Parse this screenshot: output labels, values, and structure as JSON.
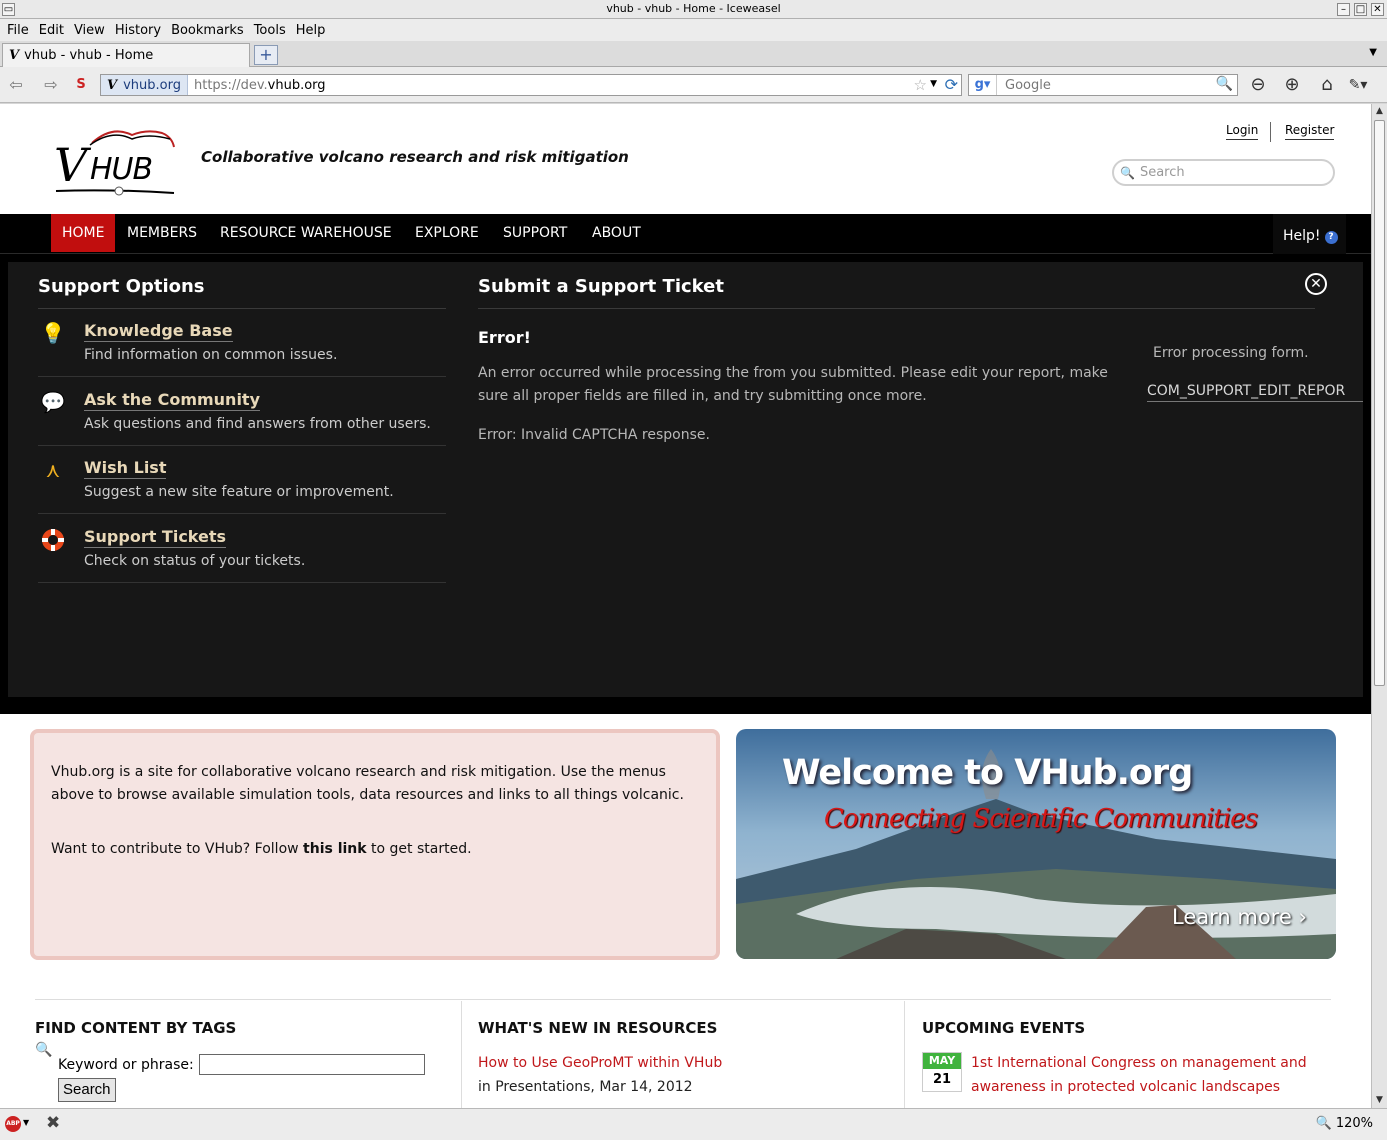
{
  "window": {
    "title": "vhub - vhub - Home - Iceweasel",
    "menu": [
      "File",
      "Edit",
      "View",
      "History",
      "Bookmarks",
      "Tools",
      "Help"
    ],
    "tab_title": "vhub - vhub - Home",
    "identity": "vhub.org",
    "url_prefix": "https://dev.",
    "url_host": "vhub.org",
    "search_engine": "Google",
    "zoom": "120%"
  },
  "header": {
    "logo_text": "VHUB",
    "tagline": "Collaborative volcano research and risk mitigation",
    "login": "Login",
    "register": "Register",
    "search_placeholder": "Search"
  },
  "nav": {
    "items": [
      "HOME",
      "MEMBERS",
      "RESOURCE WAREHOUSE",
      "EXPLORE",
      "SUPPORT",
      "ABOUT"
    ],
    "active": "HOME",
    "help": "Help!",
    "active_color": "#c10e0e"
  },
  "support": {
    "options_title": "Support Options",
    "options": [
      {
        "title": "Knowledge Base",
        "desc": "Find information on common issues.",
        "icon": "lightbulb-icon"
      },
      {
        "title": "Ask the Community",
        "desc": "Ask questions and find answers from other users.",
        "icon": "chat-bubbles-icon"
      },
      {
        "title": "Wish List",
        "desc": "Suggest a new site feature or improvement.",
        "icon": "wishbone-icon"
      },
      {
        "title": "Support Tickets",
        "desc": "Check on status of your tickets.",
        "icon": "lifebuoy-icon"
      }
    ],
    "ticket_title": "Submit a Support Ticket",
    "error_heading": "Error!",
    "error_message": "An error occurred while processing the from you submitted. Please edit your report, make sure all proper fields are filled in, and try submitting once more.",
    "error_detail": "Error: Invalid CAPTCHA response.",
    "error_processing": "Error processing form.",
    "error_code": "COM_SUPPORT_EDIT_REPOR"
  },
  "intro": {
    "p1": "Vhub.org is a site for collaborative volcano research and risk mitigation. Use the menus above to browse available simulation tools, data resources and links to all things volcanic.",
    "p2_before": "Want to contribute to VHub? Follow ",
    "p2_link": "this link",
    "p2_after": " to get started."
  },
  "banner": {
    "title": "Welcome to VHub.org",
    "subtitle": "Connecting Scientific Communities",
    "learn_more": "Learn more ›"
  },
  "tags": {
    "heading": "FIND CONTENT BY TAGS",
    "label": "Keyword or phrase:",
    "button": "Search"
  },
  "resources": {
    "heading": "WHAT'S NEW IN RESOURCES",
    "link": "How to Use GeoProMT within VHub",
    "meta": "in Presentations, Mar 14, 2012"
  },
  "events": {
    "heading": "UPCOMING EVENTS",
    "month": "MAY",
    "day": "21",
    "link": "1st International Congress on management and awareness in protected volcanic landscapes"
  }
}
